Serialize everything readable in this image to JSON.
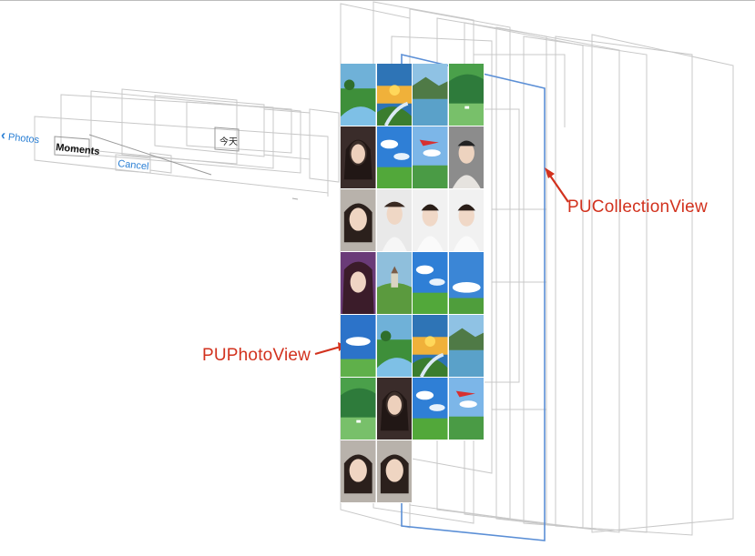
{
  "nav": {
    "back_chevron": "chevron-left-icon",
    "back_label": "Photos",
    "title": "Moments",
    "cancel_label": "Cancel",
    "section_header": "今天"
  },
  "annotations": {
    "collection_view": "PUCollectionView",
    "photo_view": "PUPhotoView"
  },
  "colors": {
    "accent": "#2a7fd4",
    "annotation": "#d2321e",
    "collection_outline": "#5b8fd6"
  },
  "photos": [
    "landscape-river",
    "landscape-sunset",
    "landscape-lake",
    "landscape-green",
    "portrait-dark",
    "landscape-sky",
    "landscape-plane",
    "portrait-fur",
    "portrait-face",
    "portrait-scarf",
    "portrait-white",
    "portrait-white",
    "portrait-hair",
    "landscape-castle",
    "landscape-sky",
    "landscape-clouds",
    "landscape-blue",
    "landscape-river",
    "landscape-sunset",
    "landscape-lake",
    "landscape-green",
    "portrait-dark",
    "landscape-sky",
    "landscape-plane",
    "portrait-face",
    "portrait-face"
  ]
}
